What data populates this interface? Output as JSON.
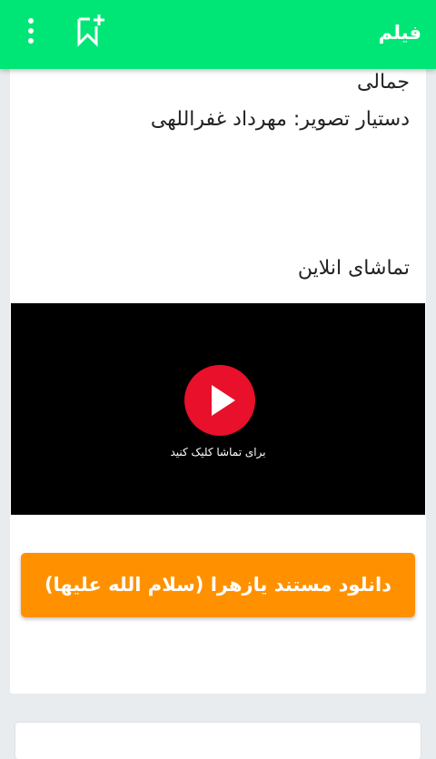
{
  "appbar": {
    "title": "فیلم",
    "background_color": "#00e676",
    "icons": [
      "more-vertical-icon",
      "bookmark-add-icon"
    ]
  },
  "content": {
    "line_1": "جمالی",
    "line_2": "دستیار تصویر: مهرداد غفراللهی",
    "section_title": "تماشای انلاین"
  },
  "video": {
    "caption": "برای تماشا کلیک کنید",
    "play_color": "#e8102a"
  },
  "download": {
    "label": "دانلود مستند یازهرا (سلام الله علیها)",
    "color": "#ff9100"
  }
}
